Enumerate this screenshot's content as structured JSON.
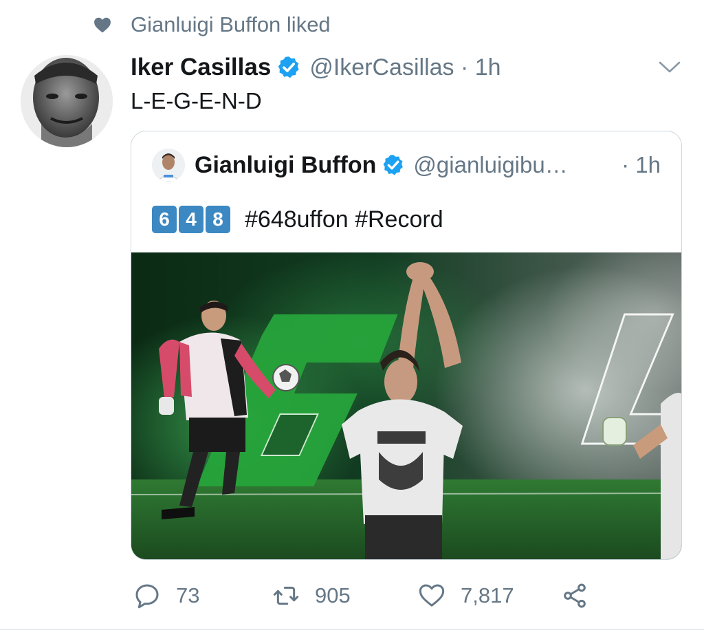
{
  "social_context": {
    "text": "Gianluigi Buffon liked"
  },
  "tweet": {
    "author_name": "Iker Casillas",
    "handle_time": "@IkerCasillas · 1h",
    "text": "L-E-G-E-N-D"
  },
  "quoted_tweet": {
    "author_name": "Gianluigi Buffon",
    "handle": "@gianluigibu…",
    "time": "· 1h",
    "keycaps": [
      "6",
      "4",
      "8"
    ],
    "hashtags": "#648uffon #Record"
  },
  "media": {
    "big_numbers": [
      "6",
      "4"
    ]
  },
  "actions": {
    "reply_count": "73",
    "retweet_count": "905",
    "like_count": "7,817"
  },
  "colors": {
    "verified": "#1da1f2",
    "secondary_text": "#657786",
    "keycap": "#3b88c3"
  },
  "icons": [
    "heart-icon",
    "verified-badge-icon",
    "chevron-down-icon",
    "reply-icon",
    "retweet-icon",
    "like-icon",
    "share-icon"
  ]
}
